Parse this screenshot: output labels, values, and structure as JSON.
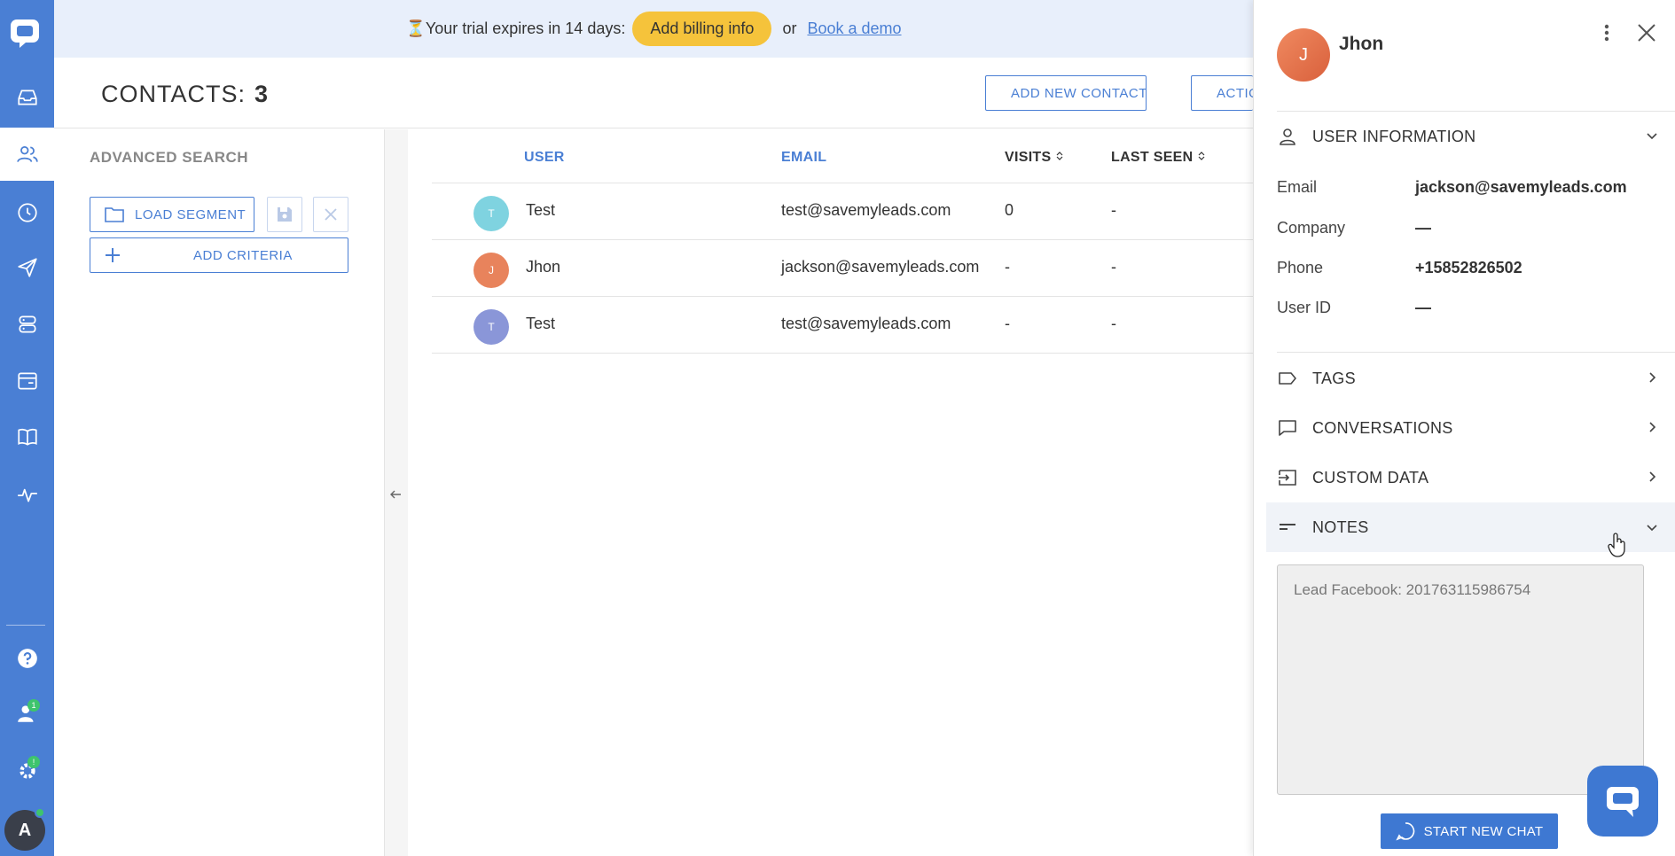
{
  "banner": {
    "trial_text": "⏳Your trial expires in 14 days:",
    "billing_label": "Add billing info",
    "or_text": "or",
    "demo_label": "Book a demo"
  },
  "header": {
    "title": "CONTACTS:",
    "count": "3",
    "add_contact_label": "ADD NEW CONTACT",
    "actions_label": "ACTIONS"
  },
  "search": {
    "title": "ADVANCED SEARCH",
    "load_segment_label": "LOAD SEGMENT",
    "add_criteria_label": "ADD CRITERIA"
  },
  "table": {
    "columns": [
      "USER",
      "EMAIL",
      "VISITS",
      "LAST SEEN"
    ],
    "rows": [
      {
        "initial": "T",
        "name": "Test",
        "email": "test@savemyleads.com",
        "visits": "0",
        "last_seen": "-",
        "avatar_color": "#7fd3e0"
      },
      {
        "initial": "J",
        "name": "Jhon",
        "email": "jackson@savemyleads.com",
        "visits": "-",
        "last_seen": "-",
        "avatar_color": "#e8835c"
      },
      {
        "initial": "T",
        "name": "Test",
        "email": "test@savemyleads.com",
        "visits": "-",
        "last_seen": "-",
        "avatar_color": "#8a96d8"
      }
    ]
  },
  "panel": {
    "initial": "J",
    "name": "Jhon",
    "user_info_title": "USER INFORMATION",
    "fields": [
      {
        "label": "Email",
        "value": "jackson@savemyleads.com"
      },
      {
        "label": "Company",
        "value": "—"
      },
      {
        "label": "Phone",
        "value": "+15852826502"
      },
      {
        "label": "User ID",
        "value": "—"
      }
    ],
    "tags_title": "TAGS",
    "conversations_title": "CONVERSATIONS",
    "custom_data_title": "CUSTOM DATA",
    "notes_title": "NOTES",
    "notes_text": "Lead Facebook: 201763115986754",
    "start_chat_label": "START NEW CHAT"
  },
  "sidebar": {
    "avatar_initial": "A",
    "badge_contacts": "1",
    "badge_settings": "!"
  },
  "colors": {
    "brand": "#4a7fd4",
    "billing": "#f5c33b",
    "online": "#3ec46d"
  }
}
